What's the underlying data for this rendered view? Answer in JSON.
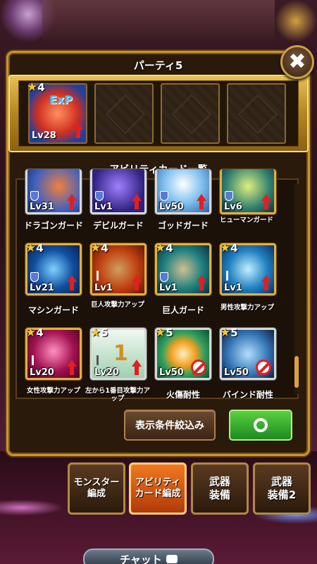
{
  "dialog": {
    "title": "パーティ5"
  },
  "party": {
    "slots": [
      {
        "stars": "4",
        "level": "Lv28",
        "filled": true,
        "badge": "ExP"
      },
      {
        "filled": false
      },
      {
        "filled": false
      },
      {
        "filled": false
      }
    ]
  },
  "list": {
    "header": "アビリティカード一覧",
    "cards": [
      {
        "name": "ドラゴンガード",
        "level": "Lv31",
        "stars": ""
      },
      {
        "name": "デビルガード",
        "level": "Lv1",
        "stars": ""
      },
      {
        "name": "ゴッドガード",
        "level": "Lv50",
        "stars": ""
      },
      {
        "name": "ヒューマンガード",
        "level": "Lv6",
        "stars": ""
      },
      {
        "name": "マシンガード",
        "level": "Lv21",
        "stars": "4"
      },
      {
        "name": "巨人攻撃力アップ",
        "level": "Lv1",
        "stars": "4"
      },
      {
        "name": "巨人ガード",
        "level": "Lv1",
        "stars": "4"
      },
      {
        "name": "男性攻撃力アップ",
        "level": "Lv1",
        "stars": "4"
      },
      {
        "name": "女性攻撃力アップ",
        "level": "Lv20",
        "stars": "4"
      },
      {
        "name": "左から1番目攻撃力アップ",
        "level": "Lv20",
        "stars": "5"
      },
      {
        "name": "火傷耐性",
        "level": "Lv50",
        "stars": "5"
      },
      {
        "name": "バインド耐性",
        "level": "Lv50",
        "stars": "5"
      }
    ]
  },
  "buttons": {
    "filter": "表示条件絞込み",
    "ok_symbol": "○"
  },
  "tabs": [
    {
      "label": "モンスター\n編成",
      "active": false
    },
    {
      "label": "アビリティ\nカード編成",
      "active": true
    },
    {
      "label": "武器\n装備",
      "active": false
    },
    {
      "label": "武器\n装備2",
      "active": false
    }
  ],
  "chat": {
    "label": "チャット"
  },
  "colors": {
    "gold_frame": "#c9962a",
    "active_tab": "#f07a20",
    "ok_green": "#3ab030",
    "up_arrow_red": "#e02020"
  },
  "icons": {
    "close": "close-icon",
    "star": "star-icon",
    "shield": "shield-icon",
    "up_arrow": "up-arrow-icon",
    "no_sign": "prohibited-icon",
    "chat": "chat-bubble-icon"
  }
}
